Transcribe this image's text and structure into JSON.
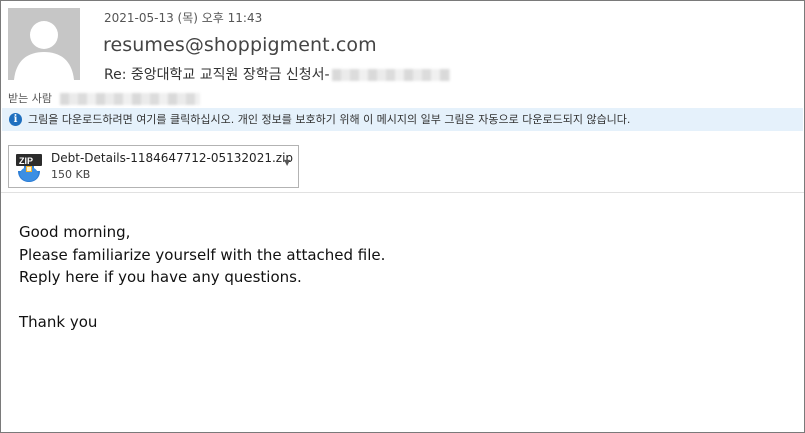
{
  "header": {
    "date": "2021-05-13 (목) 오후 11:43",
    "sender": "resumes@shoppigment.com",
    "subject": "Re: 중앙대학교 교직원 장학금 신청서-",
    "to_label": "받는 사람"
  },
  "infobar": {
    "icon": "info-icon",
    "text": "그림을 다운로드하려면 여기를 클릭하십시오. 개인 정보를 보호하기 위해 이 메시지의 일부 그림은 자동으로 다운로드되지 않습니다."
  },
  "attachment": {
    "icon": "zip-file-icon",
    "icon_label": "ZIP",
    "filename": "Debt-Details-1184647712-05132021.zip",
    "size": "150 KB"
  },
  "body": {
    "greeting": "Good morning,",
    "line1": "Please familiarize yourself with the attached file.",
    "line2": "Reply here if you have any questions.",
    "closing": "Thank you"
  },
  "colors": {
    "infobar_bg": "#e5f1fb",
    "info_icon": "#1e6fbf",
    "avatar_bg": "#c6c6c6"
  }
}
